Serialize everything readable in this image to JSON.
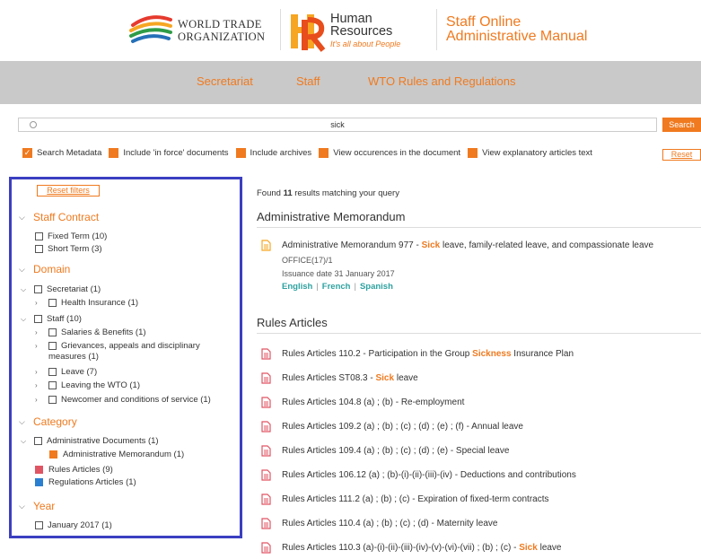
{
  "header": {
    "wto_line1": "WORLD TRADE",
    "wto_line2": "ORGANIZATION",
    "hr_line1": "Human",
    "hr_line2": "Resources",
    "hr_tagline": "It's all about People",
    "som_line1": "Staff Online",
    "som_line2": "Administrative Manual"
  },
  "nav": {
    "items": [
      "Secretariat",
      "Staff",
      "WTO Rules and Regulations"
    ]
  },
  "search": {
    "value": "sick",
    "button": "Search"
  },
  "filters": {
    "options": [
      {
        "label": "Search Metadata",
        "checked": true
      },
      {
        "label": "Include 'in force' documents",
        "checked": false
      },
      {
        "label": "Include archives",
        "checked": false
      },
      {
        "label": "View occurences in the document",
        "checked": false
      },
      {
        "label": "View explanatory articles text",
        "checked": false
      }
    ],
    "reset": "Reset"
  },
  "sidebar": {
    "reset_filters": "Reset filters",
    "staff_contract": {
      "title": "Staff Contract",
      "items": [
        "Fixed Term (10)",
        "Short Term (3)"
      ]
    },
    "domain": {
      "title": "Domain",
      "secretariat": "Secretariat (1)",
      "health_insurance": "Health Insurance (1)",
      "staff": "Staff (10)",
      "salaries": "Salaries & Benefits (1)",
      "grievances_1": "Grievances, appeals and disciplinary",
      "grievances_2": "measures (1)",
      "leave": "Leave (7)",
      "leaving": "Leaving the WTO (1)",
      "newcomer": "Newcomer and conditions of service (1)"
    },
    "category": {
      "title": "Category",
      "admin_docs": "Administrative Documents (1)",
      "admin_memo": "Administrative Memorandum (1)",
      "rules": "Rules Articles (9)",
      "regulations": "Regulations Articles (1)"
    },
    "year": {
      "title": "Year",
      "item": "January 2017 (1)"
    }
  },
  "results": {
    "found_prefix": "Found ",
    "found_count": "11",
    "found_suffix": " results matching your query",
    "admin_section": "Administrative Memorandum",
    "memo": {
      "title_before": "Administrative Memorandum 977 - ",
      "title_hl": "Sick",
      "title_after": " leave, family-related leave, and compassionate leave",
      "code": "OFFICE(17)/1",
      "issuance": "Issuance date 31 January 2017",
      "langs": [
        "English",
        "French",
        "Spanish"
      ]
    },
    "rules_section": "Rules Articles",
    "rules": [
      {
        "before": "Rules Articles 110.2 - Participation in the Group ",
        "hl": "Sickness",
        "after": " Insurance Plan"
      },
      {
        "before": "Rules Articles ST08.3 - ",
        "hl": "Sick",
        "after": " leave"
      },
      {
        "before": "Rules Articles 104.8 (a) ; (b) - Re-employment",
        "hl": "",
        "after": ""
      },
      {
        "before": "Rules Articles 109.2 (a) ; (b) ; (c) ; (d) ; (e) ; (f) - Annual leave",
        "hl": "",
        "after": ""
      },
      {
        "before": "Rules Articles 109.4 (a) ; (b) ; (c) ; (d) ; (e) - Special leave",
        "hl": "",
        "after": ""
      },
      {
        "before": "Rules Articles 106.12 (a) ; (b)-(i)-(ii)-(iii)-(iv) - Deductions and contributions",
        "hl": "",
        "after": ""
      },
      {
        "before": "Rules Articles 111.2 (a) ; (b) ; (c) - Expiration of fixed-term contracts",
        "hl": "",
        "after": ""
      },
      {
        "before": "Rules Articles 110.4 (a) ; (b) ; (c) ; (d) - Maternity leave",
        "hl": "",
        "after": ""
      },
      {
        "before": "Rules Articles 110.3 (a)-(i)-(ii)-(iii)-(iv)-(v)-(vi)-(vii) ; (b) ; (c) - ",
        "hl": "Sick",
        "after": " leave"
      }
    ]
  }
}
